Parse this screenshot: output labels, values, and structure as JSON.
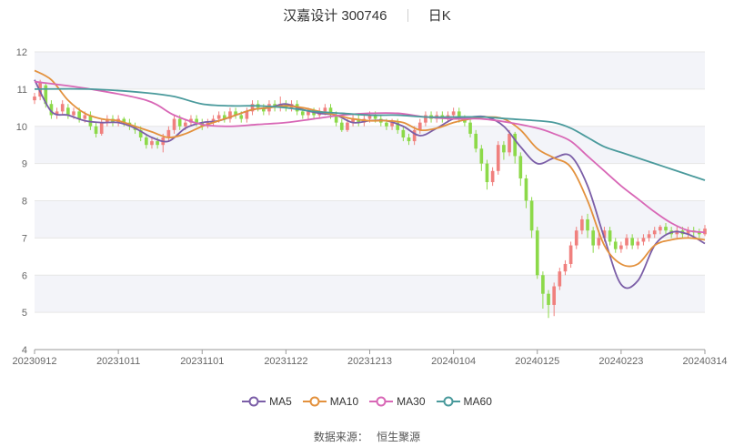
{
  "title": {
    "stock": "汉嘉设计 300746",
    "period": "日K"
  },
  "source": {
    "label": "数据来源：",
    "name": "恒生聚源"
  },
  "chart_data": {
    "type": "candlestick",
    "ylim": [
      4,
      12
    ],
    "y_ticks": [
      4,
      5,
      6,
      7,
      8,
      9,
      10,
      11,
      12
    ],
    "x_tick_labels": [
      "20230912",
      "20231011",
      "20231101",
      "20231122",
      "20231213",
      "20240104",
      "20240125",
      "20240223",
      "20240314"
    ],
    "num_points": 121,
    "x_tick_indices": [
      0,
      15,
      30,
      45,
      60,
      75,
      90,
      105,
      120
    ],
    "colors": {
      "up": "#f0807e",
      "down": "#8cd949",
      "MA5": "#7b5ea7",
      "MA10": "#e3913d",
      "MA30": "#d867b6",
      "MA60": "#4a9a9c",
      "band": "#f3f4f9",
      "grid": "#e6e6e6"
    },
    "candles": [
      [
        10.7,
        10.8,
        10.9,
        10.6
      ],
      [
        10.8,
        11.2,
        11.25,
        10.7
      ],
      [
        11.1,
        10.6,
        11.15,
        10.5
      ],
      [
        10.6,
        10.3,
        10.7,
        10.2
      ],
      [
        10.3,
        10.4,
        10.5,
        10.2
      ],
      [
        10.4,
        10.6,
        10.7,
        10.3
      ],
      [
        10.5,
        10.3,
        10.6,
        10.2
      ],
      [
        10.3,
        10.4,
        10.5,
        10.2
      ],
      [
        10.4,
        10.2,
        10.5,
        10.1
      ],
      [
        10.2,
        10.3,
        10.4,
        10.1
      ],
      [
        10.3,
        10.0,
        10.4,
        9.9
      ],
      [
        10.0,
        9.8,
        10.1,
        9.7
      ],
      [
        9.8,
        10.1,
        10.2,
        9.75
      ],
      [
        10.1,
        10.2,
        10.3,
        10.0
      ],
      [
        10.2,
        10.1,
        10.3,
        10.0
      ],
      [
        10.1,
        10.2,
        10.3,
        10.0
      ],
      [
        10.2,
        10.1,
        10.25,
        10.0
      ],
      [
        10.1,
        10.0,
        10.2,
        9.9
      ],
      [
        10.0,
        9.9,
        10.1,
        9.8
      ],
      [
        9.9,
        9.7,
        10.0,
        9.6
      ],
      [
        9.7,
        9.5,
        9.8,
        9.4
      ],
      [
        9.5,
        9.6,
        9.7,
        9.4
      ],
      [
        9.6,
        9.5,
        9.7,
        9.4
      ],
      [
        9.5,
        9.7,
        9.8,
        9.3
      ],
      [
        9.7,
        9.9,
        10.0,
        9.6
      ],
      [
        9.9,
        10.2,
        10.3,
        9.8
      ],
      [
        10.2,
        10.0,
        10.3,
        9.9
      ],
      [
        10.0,
        10.1,
        10.2,
        9.9
      ],
      [
        10.1,
        10.2,
        10.3,
        10.0
      ],
      [
        10.2,
        10.1,
        10.3,
        10.0
      ],
      [
        10.1,
        10.0,
        10.2,
        9.9
      ],
      [
        10.0,
        10.1,
        10.2,
        9.95
      ],
      [
        10.1,
        10.2,
        10.3,
        10.0
      ],
      [
        10.2,
        10.3,
        10.4,
        10.1
      ],
      [
        10.3,
        10.2,
        10.4,
        10.1
      ],
      [
        10.2,
        10.4,
        10.5,
        10.1
      ],
      [
        10.4,
        10.3,
        10.5,
        10.2
      ],
      [
        10.3,
        10.2,
        10.4,
        10.1
      ],
      [
        10.2,
        10.4,
        10.5,
        10.1
      ],
      [
        10.4,
        10.6,
        10.7,
        10.3
      ],
      [
        10.6,
        10.5,
        10.7,
        10.4
      ],
      [
        10.5,
        10.4,
        10.6,
        10.3
      ],
      [
        10.4,
        10.6,
        10.7,
        10.3
      ],
      [
        10.6,
        10.5,
        10.7,
        10.4
      ],
      [
        10.5,
        10.6,
        10.8,
        10.4
      ],
      [
        10.6,
        10.5,
        10.7,
        10.4
      ],
      [
        10.5,
        10.6,
        10.7,
        10.4
      ],
      [
        10.6,
        10.4,
        10.7,
        10.3
      ],
      [
        10.4,
        10.3,
        10.5,
        10.2
      ],
      [
        10.3,
        10.4,
        10.5,
        10.2
      ],
      [
        10.4,
        10.3,
        10.5,
        10.2
      ],
      [
        10.3,
        10.4,
        10.5,
        10.2
      ],
      [
        10.4,
        10.5,
        10.6,
        10.3
      ],
      [
        10.5,
        10.3,
        10.6,
        10.2
      ],
      [
        10.3,
        10.1,
        10.4,
        10.0
      ],
      [
        10.1,
        9.9,
        10.2,
        9.85
      ],
      [
        9.9,
        10.1,
        10.2,
        9.85
      ],
      [
        10.1,
        10.2,
        10.3,
        10.0
      ],
      [
        10.2,
        10.1,
        10.3,
        10.0
      ],
      [
        10.1,
        10.2,
        10.3,
        10.0
      ],
      [
        10.2,
        10.3,
        10.4,
        10.1
      ],
      [
        10.3,
        10.2,
        10.4,
        10.1
      ],
      [
        10.2,
        10.1,
        10.3,
        10.0
      ],
      [
        10.1,
        10.0,
        10.2,
        9.9
      ],
      [
        10.0,
        10.1,
        10.2,
        9.9
      ],
      [
        10.1,
        9.9,
        10.2,
        9.8
      ],
      [
        9.9,
        9.7,
        10.0,
        9.6
      ],
      [
        9.7,
        9.6,
        9.8,
        9.5
      ],
      [
        9.6,
        9.9,
        10.0,
        9.5
      ],
      [
        9.9,
        10.1,
        10.2,
        9.8
      ],
      [
        10.1,
        10.3,
        10.4,
        10.0
      ],
      [
        10.3,
        10.2,
        10.4,
        10.1
      ],
      [
        10.2,
        10.3,
        10.4,
        10.1
      ],
      [
        10.3,
        10.2,
        10.4,
        10.1
      ],
      [
        10.2,
        10.3,
        10.4,
        10.1
      ],
      [
        10.3,
        10.4,
        10.5,
        10.2
      ],
      [
        10.4,
        10.2,
        10.5,
        10.1
      ],
      [
        10.2,
        10.1,
        10.3,
        10.0
      ],
      [
        10.1,
        9.8,
        10.2,
        9.7
      ],
      [
        9.8,
        9.4,
        9.9,
        9.3
      ],
      [
        9.4,
        9.0,
        9.5,
        8.8
      ],
      [
        9.0,
        8.5,
        9.1,
        8.3
      ],
      [
        8.5,
        8.8,
        8.9,
        8.4
      ],
      [
        8.8,
        9.5,
        9.6,
        8.7
      ],
      [
        9.5,
        9.3,
        9.6,
        9.1
      ],
      [
        9.3,
        9.8,
        9.9,
        9.2
      ],
      [
        9.8,
        9.2,
        9.85,
        9.0
      ],
      [
        9.2,
        8.6,
        9.3,
        8.4
      ],
      [
        8.6,
        8.0,
        8.7,
        7.8
      ],
      [
        8.0,
        7.2,
        8.1,
        7.0
      ],
      [
        7.2,
        6.0,
        7.3,
        5.9
      ],
      [
        6.0,
        5.5,
        6.1,
        5.1
      ],
      [
        5.5,
        5.2,
        5.6,
        4.85
      ],
      [
        5.2,
        5.7,
        5.8,
        4.9
      ],
      [
        5.7,
        6.1,
        6.2,
        5.6
      ],
      [
        6.1,
        6.3,
        6.4,
        6.0
      ],
      [
        6.3,
        6.8,
        6.9,
        6.2
      ],
      [
        6.8,
        7.2,
        7.3,
        6.7
      ],
      [
        7.2,
        7.5,
        7.6,
        7.1
      ],
      [
        7.5,
        7.2,
        7.65,
        7.0
      ],
      [
        7.2,
        6.8,
        7.3,
        6.6
      ],
      [
        6.8,
        7.0,
        7.2,
        6.7
      ],
      [
        7.0,
        7.2,
        7.3,
        6.9
      ],
      [
        7.2,
        6.9,
        7.3,
        6.8
      ],
      [
        6.9,
        6.7,
        7.0,
        6.6
      ],
      [
        6.7,
        6.8,
        6.9,
        6.6
      ],
      [
        6.8,
        7.0,
        7.1,
        6.7
      ],
      [
        7.0,
        6.8,
        7.1,
        6.7
      ],
      [
        6.8,
        6.9,
        7.0,
        6.7
      ],
      [
        6.9,
        7.0,
        7.1,
        6.8
      ],
      [
        7.0,
        7.1,
        7.2,
        6.9
      ],
      [
        7.1,
        7.2,
        7.3,
        7.0
      ],
      [
        7.2,
        7.3,
        7.35,
        7.1
      ],
      [
        7.3,
        7.2,
        7.4,
        7.1
      ],
      [
        7.2,
        7.1,
        7.3,
        7.0
      ],
      [
        7.1,
        7.2,
        7.3,
        7.0
      ],
      [
        7.2,
        7.1,
        7.3,
        7.0
      ],
      [
        7.1,
        7.2,
        7.3,
        7.0
      ],
      [
        7.2,
        7.15,
        7.3,
        7.05
      ],
      [
        7.15,
        7.1,
        7.25,
        7.0
      ],
      [
        7.1,
        7.25,
        7.35,
        7.05
      ]
    ],
    "series": [
      {
        "name": "MA5",
        "points": [
          [
            0,
            11.25
          ],
          [
            3,
            10.4
          ],
          [
            6,
            10.3
          ],
          [
            9,
            10.15
          ],
          [
            12,
            10.1
          ],
          [
            15,
            10.1
          ],
          [
            18,
            9.95
          ],
          [
            21,
            9.7
          ],
          [
            24,
            9.6
          ],
          [
            27,
            9.95
          ],
          [
            30,
            10.1
          ],
          [
            33,
            10.15
          ],
          [
            36,
            10.3
          ],
          [
            39,
            10.45
          ],
          [
            42,
            10.5
          ],
          [
            45,
            10.6
          ],
          [
            48,
            10.45
          ],
          [
            51,
            10.35
          ],
          [
            54,
            10.3
          ],
          [
            57,
            10.1
          ],
          [
            60,
            10.15
          ],
          [
            63,
            10.15
          ],
          [
            66,
            10.0
          ],
          [
            69,
            9.75
          ],
          [
            72,
            9.95
          ],
          [
            75,
            10.2
          ],
          [
            78,
            10.25
          ],
          [
            81,
            10.25
          ],
          [
            84,
            10.0
          ],
          [
            87,
            9.45
          ],
          [
            90,
            9.0
          ],
          [
            93,
            9.15
          ],
          [
            96,
            9.2
          ],
          [
            99,
            8.4
          ],
          [
            102,
            7.0
          ],
          [
            105,
            5.75
          ],
          [
            108,
            5.85
          ],
          [
            111,
            6.8
          ],
          [
            114,
            7.15
          ],
          [
            117,
            7.1
          ],
          [
            120,
            6.85
          ]
        ]
      },
      {
        "name": "MA10",
        "points": [
          [
            0,
            11.5
          ],
          [
            3,
            11.25
          ],
          [
            6,
            10.7
          ],
          [
            9,
            10.35
          ],
          [
            12,
            10.2
          ],
          [
            15,
            10.15
          ],
          [
            18,
            10.0
          ],
          [
            21,
            9.85
          ],
          [
            24,
            9.7
          ],
          [
            27,
            9.8
          ],
          [
            30,
            10.0
          ],
          [
            33,
            10.15
          ],
          [
            36,
            10.3
          ],
          [
            39,
            10.45
          ],
          [
            42,
            10.5
          ],
          [
            45,
            10.55
          ],
          [
            48,
            10.5
          ],
          [
            51,
            10.4
          ],
          [
            54,
            10.3
          ],
          [
            57,
            10.2
          ],
          [
            60,
            10.15
          ],
          [
            63,
            10.15
          ],
          [
            66,
            10.1
          ],
          [
            69,
            9.9
          ],
          [
            72,
            9.95
          ],
          [
            75,
            10.1
          ],
          [
            78,
            10.2
          ],
          [
            81,
            10.25
          ],
          [
            84,
            10.2
          ],
          [
            87,
            9.9
          ],
          [
            90,
            9.4
          ],
          [
            93,
            9.15
          ],
          [
            96,
            8.9
          ],
          [
            99,
            8.0
          ],
          [
            102,
            6.8
          ],
          [
            105,
            6.3
          ],
          [
            108,
            6.3
          ],
          [
            111,
            6.8
          ],
          [
            114,
            6.95
          ],
          [
            117,
            7.0
          ],
          [
            120,
            6.95
          ]
        ]
      },
      {
        "name": "MA30",
        "points": [
          [
            0,
            11.2
          ],
          [
            10,
            11.0
          ],
          [
            20,
            10.7
          ],
          [
            25,
            10.3
          ],
          [
            30,
            10.05
          ],
          [
            35,
            10.0
          ],
          [
            40,
            10.05
          ],
          [
            45,
            10.1
          ],
          [
            50,
            10.2
          ],
          [
            55,
            10.3
          ],
          [
            60,
            10.35
          ],
          [
            65,
            10.35
          ],
          [
            70,
            10.25
          ],
          [
            75,
            10.2
          ],
          [
            80,
            10.2
          ],
          [
            85,
            10.1
          ],
          [
            90,
            9.95
          ],
          [
            93,
            9.8
          ],
          [
            96,
            9.6
          ],
          [
            99,
            9.2
          ],
          [
            102,
            8.8
          ],
          [
            105,
            8.4
          ],
          [
            108,
            8.05
          ],
          [
            111,
            7.7
          ],
          [
            114,
            7.4
          ],
          [
            117,
            7.2
          ],
          [
            120,
            7.15
          ]
        ]
      },
      {
        "name": "MA60",
        "points": [
          [
            0,
            11.0
          ],
          [
            10,
            11.0
          ],
          [
            20,
            10.9
          ],
          [
            25,
            10.8
          ],
          [
            30,
            10.6
          ],
          [
            35,
            10.55
          ],
          [
            40,
            10.55
          ],
          [
            45,
            10.5
          ],
          [
            50,
            10.4
          ],
          [
            55,
            10.35
          ],
          [
            60,
            10.3
          ],
          [
            65,
            10.3
          ],
          [
            70,
            10.25
          ],
          [
            75,
            10.25
          ],
          [
            80,
            10.25
          ],
          [
            85,
            10.2
          ],
          [
            90,
            10.15
          ],
          [
            93,
            10.1
          ],
          [
            96,
            9.95
          ],
          [
            99,
            9.7
          ],
          [
            102,
            9.45
          ],
          [
            105,
            9.3
          ],
          [
            108,
            9.15
          ],
          [
            111,
            9.0
          ],
          [
            114,
            8.85
          ],
          [
            117,
            8.7
          ],
          [
            120,
            8.55
          ]
        ]
      }
    ],
    "legend": [
      "MA5",
      "MA10",
      "MA30",
      "MA60"
    ],
    "legend_position": "bottom-center",
    "grid": true
  }
}
